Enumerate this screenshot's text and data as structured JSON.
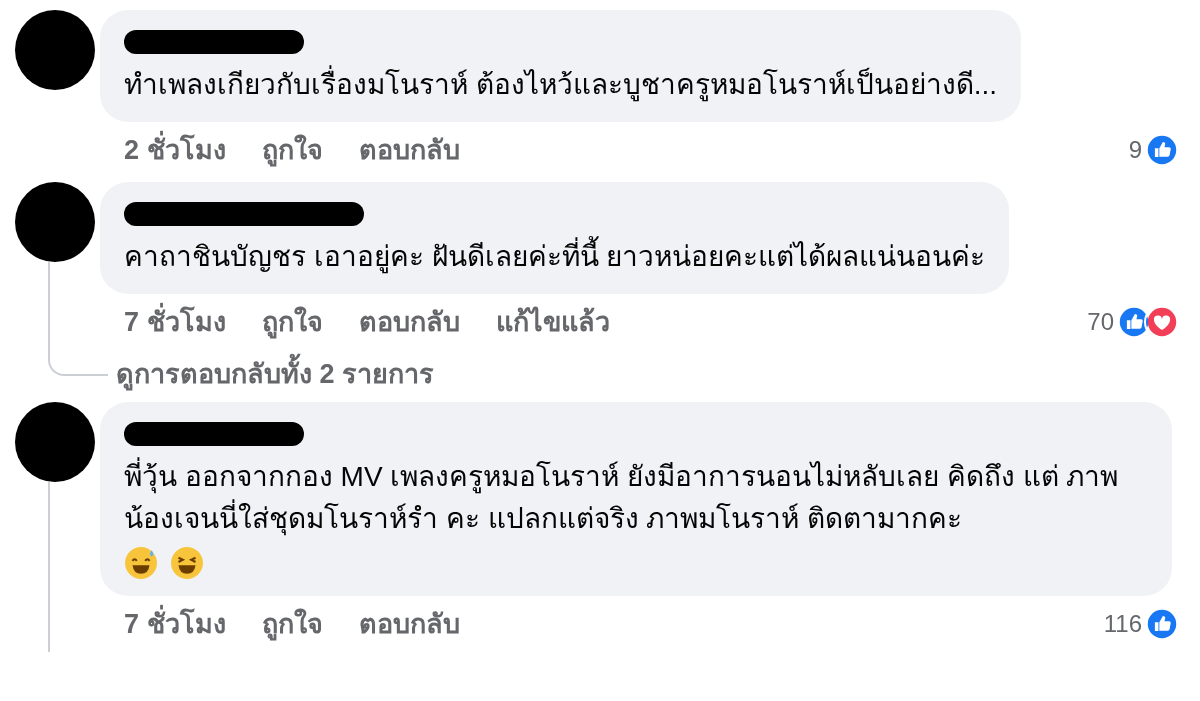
{
  "comments": [
    {
      "text": "ทำเพลงเกียวกับเรื่องมโนราห์ ต้องไหว้และบูชาครูหมอโนราห์เป็นอย่างดี...",
      "time": "2 ชั่วโมง",
      "actions": [
        "ถูกใจ",
        "ตอบกลับ"
      ],
      "reaction_count": "9",
      "reactions": [
        {
          "kind": "like"
        }
      ],
      "thread": false
    },
    {
      "text": "คาถาชินบัญชร เอาอยู่คะ ฝันดีเลยค่ะที่นี้ ยาวหน่อยคะแต่ได้ผลแน่นอนค่ะ",
      "time": "7 ชั่วโมง",
      "actions": [
        "ถูกใจ",
        "ตอบกลับ"
      ],
      "edited": "แก้ไขแล้ว",
      "reaction_count": "70",
      "reactions": [
        {
          "kind": "like"
        },
        {
          "kind": "love"
        }
      ],
      "thread": true,
      "replies_link": "ดูการตอบกลับทั้ง 2 รายการ"
    },
    {
      "text": "พี่วุ้น ออกจากกอง MV เพลงครูหมอโนราห์ ยังมีอาการนอนไม่หลับเลย คิดถึง แต่ ภาพน้องเจนนี่ใส่ชุดมโนราห์รำ คะ แปลกแต่จริง ภาพมโนราห์ ติดตามากคะ",
      "emoji": [
        {
          "kind": "sweat-smile"
        },
        {
          "kind": "laughing"
        }
      ],
      "time": "7 ชั่วโมง",
      "actions": [
        "ถูกใจ",
        "ตอบกลับ"
      ],
      "reaction_count": "116",
      "reactions": [
        {
          "kind": "like"
        }
      ],
      "thread": true
    }
  ]
}
